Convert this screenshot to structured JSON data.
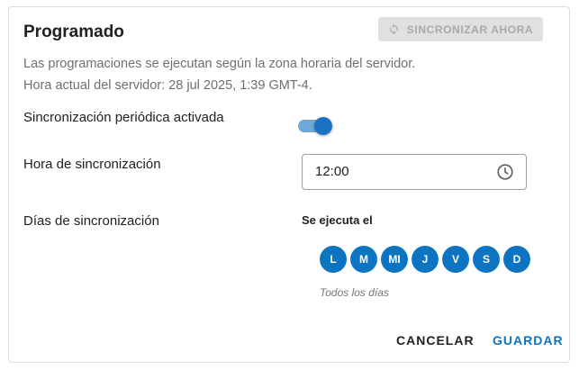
{
  "header": {
    "title": "Programado",
    "sync_button_label": "SINCRONIZAR AHORA",
    "sync_icon": "sync-icon"
  },
  "description": {
    "line1": "Las programaciones se ejecutan según la zona horaria del servidor.",
    "line2": "Hora actual del servidor: 28 jul 2025, 1:39 GMT-4."
  },
  "periodic_sync": {
    "label": "Sincronización periódica activada",
    "enabled": true
  },
  "sync_time": {
    "label": "Hora de sincronización",
    "value": "12:00",
    "icon": "clock-icon"
  },
  "sync_days": {
    "label": "Días de sincronización",
    "runs_label": "Se ejecuta el",
    "days": [
      "L",
      "M",
      "MI",
      "J",
      "V",
      "S",
      "D"
    ],
    "summary": "Todos los días"
  },
  "footer": {
    "cancel_label": "CANCELAR",
    "save_label": "GUARDAR"
  },
  "colors": {
    "accent": "#0d74c2",
    "disabled_button_bg": "#e0e0e0"
  }
}
